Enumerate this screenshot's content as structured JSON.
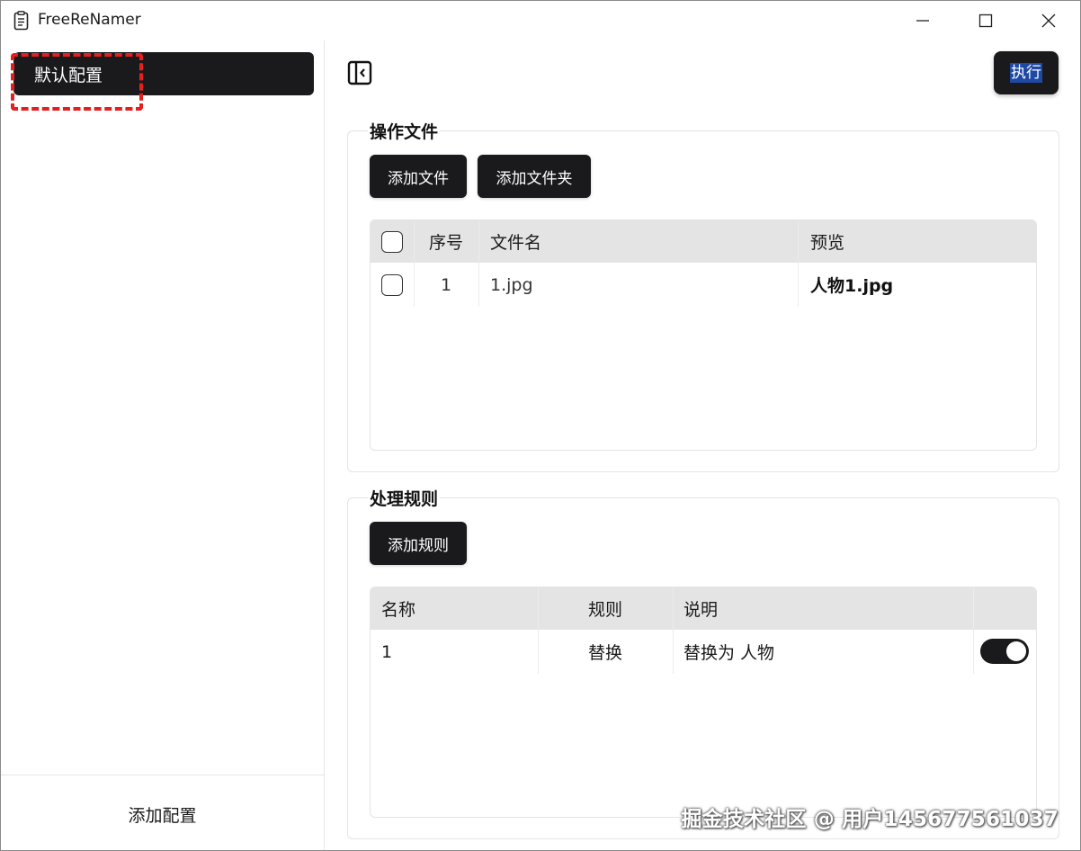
{
  "window": {
    "title": "FreeReNamer",
    "controls": [
      "minimize-icon",
      "maximize-icon",
      "close-icon"
    ]
  },
  "sidebar": {
    "profiles": [
      {
        "label": "默认配置",
        "selected": true
      }
    ],
    "add_profile_label": "添加配置"
  },
  "toolbar": {
    "toggle_icon": "sidebar-toggle-icon",
    "execute_label": "执行"
  },
  "files_section": {
    "title": "操作文件",
    "add_file_label": "添加文件",
    "add_folder_label": "添加文件夹",
    "columns": {
      "index": "序号",
      "filename": "文件名",
      "preview": "预览"
    },
    "rows": [
      {
        "index": "1",
        "filename": "1.jpg",
        "preview": "人物1.jpg",
        "checked": false
      }
    ]
  },
  "rules_section": {
    "title": "处理规则",
    "add_rule_label": "添加规则",
    "columns": {
      "name": "名称",
      "rule": "规则",
      "description": "说明"
    },
    "rows": [
      {
        "name": "1",
        "rule": "替换",
        "description": "替换为 人物",
        "enabled": true
      }
    ]
  },
  "watermark": "掘金技术社区 @ 用户145677561037",
  "colors": {
    "dark": "#1a1a1c",
    "header_bg": "#e4e4e4",
    "highlight": "#e32020",
    "execute_text_bg": "#1e4aa6"
  }
}
